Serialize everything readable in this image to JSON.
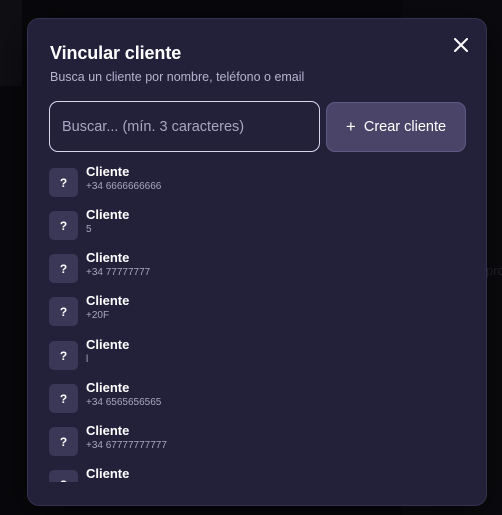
{
  "background": {
    "right_text": "pro"
  },
  "modal": {
    "title": "Vincular cliente",
    "subtitle": "Busca un cliente por nombre, teléfono o email",
    "search": {
      "placeholder": "Buscar... (mín. 3 caracteres)",
      "value": ""
    },
    "create_button": {
      "icon": "+",
      "label": "Crear cliente"
    },
    "clients": [
      {
        "avatar": "?",
        "name": "Cliente",
        "phone": "+34 6666666666"
      },
      {
        "avatar": "?",
        "name": "Cliente",
        "phone": "5"
      },
      {
        "avatar": "?",
        "name": "Cliente",
        "phone": "+34 77777777"
      },
      {
        "avatar": "?",
        "name": "Cliente",
        "phone": "+20F"
      },
      {
        "avatar": "?",
        "name": "Cliente",
        "phone": "l"
      },
      {
        "avatar": "?",
        "name": "Cliente",
        "phone": "+34 6565656565"
      },
      {
        "avatar": "?",
        "name": "Cliente",
        "phone": "+34 67777777777"
      },
      {
        "avatar": "?",
        "name": "Cliente",
        "phone": ""
      }
    ]
  },
  "colors": {
    "modal_bg": "#23203a",
    "accent_button": "#4a4568",
    "muted_text": "#a9a5c2"
  }
}
